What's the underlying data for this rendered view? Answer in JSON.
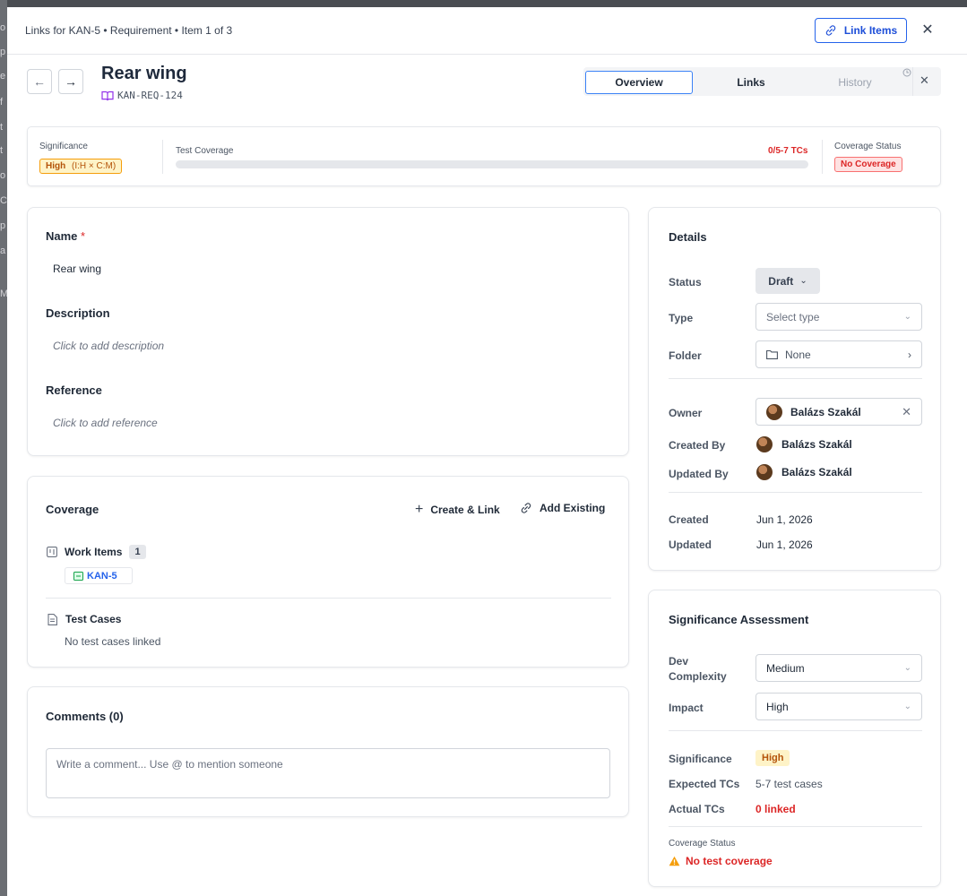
{
  "background_letters": [
    "o",
    "p",
    "e",
    "f",
    "t",
    "t",
    "o",
    "C",
    "p",
    "a",
    "M"
  ],
  "topbar": {
    "breadcrumb": "Links for KAN-5 • Requirement • Item 1 of 3",
    "link_items_label": "Link Items",
    "close_glyph": "✕"
  },
  "header": {
    "back_glyph": "←",
    "forward_glyph": "→",
    "title": "Rear wing",
    "key": "KAN-REQ-124"
  },
  "tabs": {
    "overview": "Overview",
    "links": "Links",
    "history": "History",
    "close_glyph": "✕"
  },
  "summary": {
    "significance_label": "Significance",
    "significance_value": "High",
    "significance_detail": "(I:H × C:M)",
    "coverage_label": "Test Coverage",
    "coverage_count": "0/5-7 TCs",
    "coverage_progress": 0,
    "status_label": "Coverage Status",
    "status_value": "No Coverage"
  },
  "main": {
    "name_label": "Name",
    "required_mark": "*",
    "name_value": "Rear wing",
    "description_label": "Description",
    "description_placeholder": "Click to add description",
    "reference_label": "Reference",
    "reference_placeholder": "Click to add reference"
  },
  "coverage": {
    "title": "Coverage",
    "create_link": "Create & Link",
    "add_existing": "Add Existing",
    "work_items_label": "Work Items",
    "work_items_count": "1",
    "work_item_key": "KAN-5",
    "test_cases_label": "Test Cases",
    "test_cases_empty": "No test cases linked"
  },
  "comments": {
    "title": "Comments (0)",
    "placeholder": "Write a comment... Use @ to mention someone"
  },
  "details": {
    "title": "Details",
    "status_label": "Status",
    "status_value": "Draft",
    "type_label": "Type",
    "type_placeholder": "Select type",
    "folder_label": "Folder",
    "folder_value": "None",
    "owner_label": "Owner",
    "owner_value": "Balázs Szakál",
    "created_by_label": "Created By",
    "created_by_value": "Balázs Szakál",
    "updated_by_label": "Updated By",
    "updated_by_value": "Balázs Szakál",
    "created_label": "Created",
    "created_value": "Jun 1, 2026",
    "updated_label": "Updated",
    "updated_value": "Jun 1, 2026"
  },
  "assessment": {
    "title": "Significance Assessment",
    "dev_label_1": "Dev",
    "dev_label_2": "Complexity",
    "dev_value": "Medium",
    "impact_label": "Impact",
    "impact_value": "High",
    "significance_label": "Significance",
    "significance_value": "High",
    "expected_label": "Expected TCs",
    "expected_value": "5-7 test cases",
    "actual_label": "Actual TCs",
    "actual_value": "0 linked",
    "coverage_status_label": "Coverage Status",
    "coverage_status_value": "No test coverage"
  },
  "colors": {
    "accent": "#2563eb",
    "danger": "#dc2626",
    "warning": "#d97706",
    "book_icon": "#9333ea"
  }
}
